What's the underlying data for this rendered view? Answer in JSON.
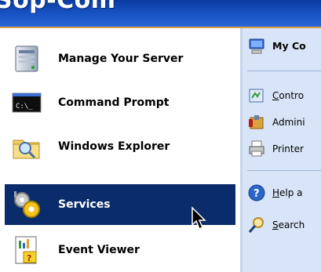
{
  "header": {
    "user_name": "Sop-Com"
  },
  "left_items": [
    {
      "label": "Manage Your Server",
      "icon": "server-icon"
    },
    {
      "label": "Command Prompt",
      "icon": "command-prompt-icon",
      "icon_text": "C:\\_"
    },
    {
      "label": "Windows Explorer",
      "icon": "folder-search-icon"
    },
    {
      "label": "Services",
      "icon": "services-gears-icon",
      "selected": true
    },
    {
      "label": "Event Viewer",
      "icon": "event-viewer-icon"
    }
  ],
  "right_items": [
    {
      "label": "My Co",
      "icon": "my-computer-icon"
    },
    {
      "label_rest": "ontro",
      "label_underline": "C",
      "icon": "control-panel-icon"
    },
    {
      "label": "Admini",
      "icon": "admin-tools-icon"
    },
    {
      "label": "Printer",
      "icon": "printer-icon"
    },
    {
      "label_underline": "H",
      "label_rest": "elp a",
      "icon": "help-icon"
    },
    {
      "label_underline": "S",
      "label_rest": "earch",
      "icon": "search-icon"
    }
  ],
  "colors": {
    "header_blue": "#1a55c8",
    "selection_navy": "#0b2c6b",
    "right_panel": "#d8e5f8"
  }
}
